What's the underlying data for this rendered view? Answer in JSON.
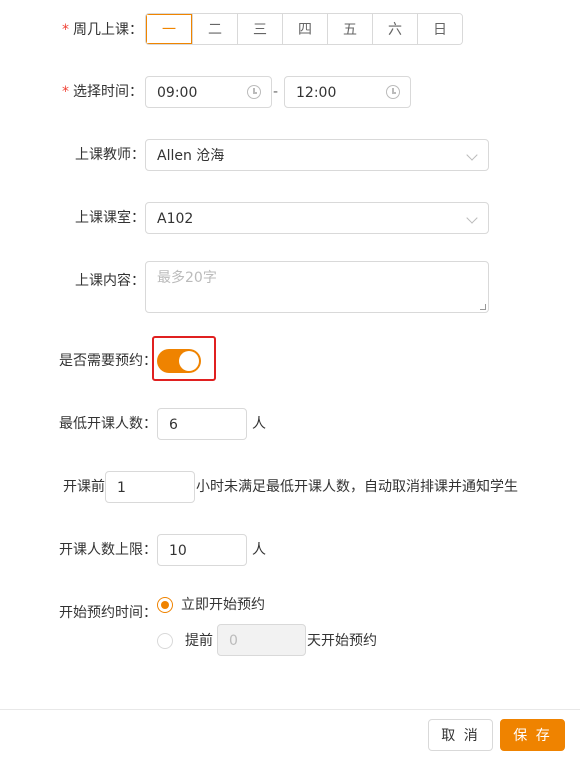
{
  "form": {
    "weekday": {
      "label": "周几上课：",
      "required_mark": "*",
      "options": [
        "一",
        "二",
        "三",
        "四",
        "五",
        "六",
        "日"
      ],
      "selected_index": 0
    },
    "time": {
      "label": "选择时间：",
      "required_mark": "*",
      "start": "09:00",
      "separator": "-",
      "end": "12:00"
    },
    "teacher": {
      "label": "上课教师：",
      "value": "Allen 沧海"
    },
    "classroom": {
      "label": "上课课室：",
      "value": "A102"
    },
    "content": {
      "label": "上课内容：",
      "placeholder": "最多20字"
    },
    "reservation": {
      "label": "是否需要预约：",
      "enabled": true
    },
    "min_students": {
      "label": "最低开课人数：",
      "value": "6",
      "unit": "人"
    },
    "auto_cancel": {
      "prefix": "开课前",
      "value": "1",
      "suffix": "小时未满足最低开课人数，自动取消排课并通知学生"
    },
    "max_students": {
      "label": "开课人数上限：",
      "value": "10",
      "unit": "人"
    },
    "booking_start": {
      "label": "开始预约时间：",
      "option_now": "立即开始预约",
      "option_advance_prefix": "提前",
      "advance_value": "0",
      "option_advance_suffix": "天开始预约",
      "selected": "now"
    }
  },
  "footer": {
    "cancel_label": "取 消",
    "save_label": "保 存"
  },
  "colors": {
    "accent": "#ef8300",
    "required": "#f04134",
    "highlight": "#e02020"
  }
}
